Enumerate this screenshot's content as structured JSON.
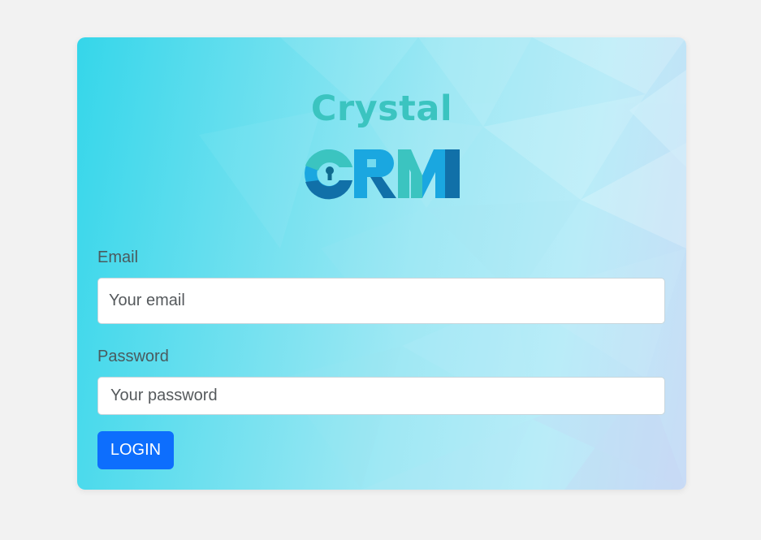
{
  "brand": {
    "word": "Crystal",
    "mark_alt": "CRM",
    "colors": {
      "teal": "#3bc4c0",
      "blue": "#1aa7e0",
      "dark_blue": "#1170a8"
    }
  },
  "form": {
    "email": {
      "label": "Email",
      "placeholder": "Your email",
      "value": ""
    },
    "password": {
      "label": "Password",
      "placeholder": "Your password",
      "value": ""
    },
    "submit_label": "LOGIN"
  },
  "theme": {
    "page_bg": "#f2f2f2",
    "button_bg": "#0d6efd",
    "card_gradient_start": "#35d6ea",
    "card_gradient_end": "#c9dcf6"
  }
}
